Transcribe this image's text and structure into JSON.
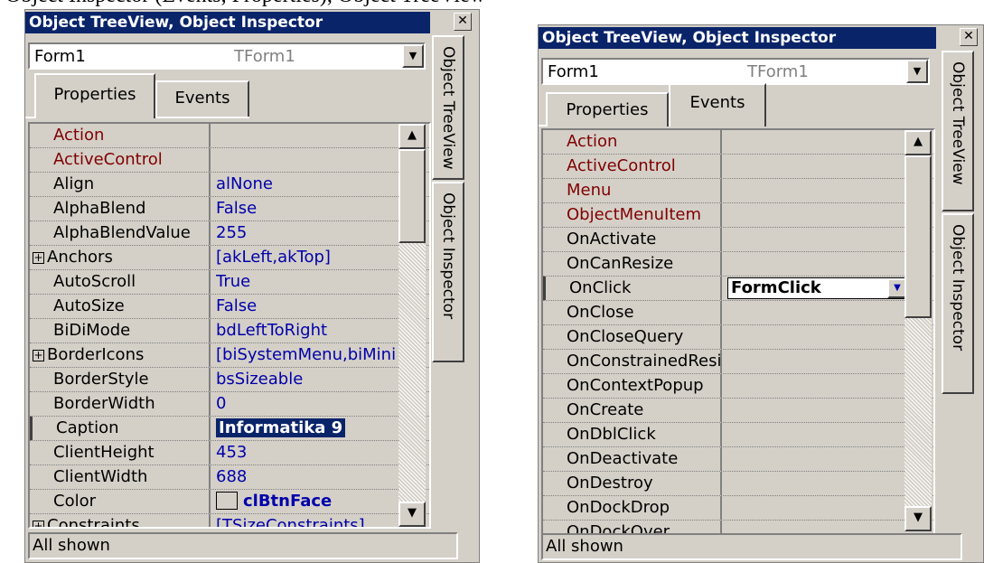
{
  "cut_text": "Object Inspector (Events, Properties), Object TreeView",
  "left_panel": {
    "title": "Object TreeView, Object Inspector",
    "close_glyph": "✕",
    "combo": {
      "name": "Form1",
      "type": "TForm1"
    },
    "tabs": [
      "Properties",
      "Events"
    ],
    "active_tab": "Properties",
    "rows": [
      {
        "name": "Action",
        "value": "",
        "red": true
      },
      {
        "name": "ActiveControl",
        "value": "",
        "red": true
      },
      {
        "name": "Align",
        "value": "alNone"
      },
      {
        "name": "AlphaBlend",
        "value": "False"
      },
      {
        "name": "AlphaBlendValue",
        "value": "255"
      },
      {
        "name": "Anchors",
        "value": "[akLeft,akTop]",
        "expand": "+"
      },
      {
        "name": "AutoScroll",
        "value": "True"
      },
      {
        "name": "AutoSize",
        "value": "False"
      },
      {
        "name": "BiDiMode",
        "value": "bdLeftToRight"
      },
      {
        "name": "BorderIcons",
        "value": "[biSystemMenu,biMinimize,biMaximize]",
        "expand": "+"
      },
      {
        "name": "BorderStyle",
        "value": "bsSizeable"
      },
      {
        "name": "BorderWidth",
        "value": "0"
      },
      {
        "name": "Caption",
        "value": "Informatika 9",
        "selected": true
      },
      {
        "name": "ClientHeight",
        "value": "453"
      },
      {
        "name": "ClientWidth",
        "value": "688"
      },
      {
        "name": "Color",
        "value": "clBtnFace",
        "swatch": true
      },
      {
        "name": "Constraints",
        "value": "[TSizeConstraints]",
        "expand": "+"
      }
    ],
    "status": "All shown",
    "side_tabs": [
      "Object TreeView",
      "Object Inspector"
    ]
  },
  "right_panel": {
    "title": "Object TreeView, Object Inspector",
    "close_glyph": "✕",
    "combo": {
      "name": "Form1",
      "type": "TForm1"
    },
    "tabs": [
      "Properties",
      "Events"
    ],
    "active_tab": "Events",
    "rows": [
      {
        "name": "Action",
        "value": "",
        "red": true
      },
      {
        "name": "ActiveControl",
        "value": "",
        "red": true
      },
      {
        "name": "Menu",
        "value": "",
        "red": true
      },
      {
        "name": "ObjectMenuItem",
        "value": "",
        "red": true
      },
      {
        "name": "OnActivate",
        "value": ""
      },
      {
        "name": "OnCanResize",
        "value": ""
      },
      {
        "name": "OnClick",
        "value": "FormClick",
        "selected": true
      },
      {
        "name": "OnClose",
        "value": ""
      },
      {
        "name": "OnCloseQuery",
        "value": ""
      },
      {
        "name": "OnConstrainedResize",
        "value": ""
      },
      {
        "name": "OnContextPopup",
        "value": ""
      },
      {
        "name": "OnCreate",
        "value": ""
      },
      {
        "name": "OnDblClick",
        "value": ""
      },
      {
        "name": "OnDeactivate",
        "value": ""
      },
      {
        "name": "OnDestroy",
        "value": ""
      },
      {
        "name": "OnDockDrop",
        "value": ""
      },
      {
        "name": "OnDockOver",
        "value": ""
      }
    ],
    "status": "All shown",
    "side_tabs": [
      "Object TreeView",
      "Object Inspector"
    ]
  },
  "glyphs": {
    "dropdown": "▼",
    "scroll_up": "▲",
    "scroll_down": "▼",
    "expand": "+"
  }
}
